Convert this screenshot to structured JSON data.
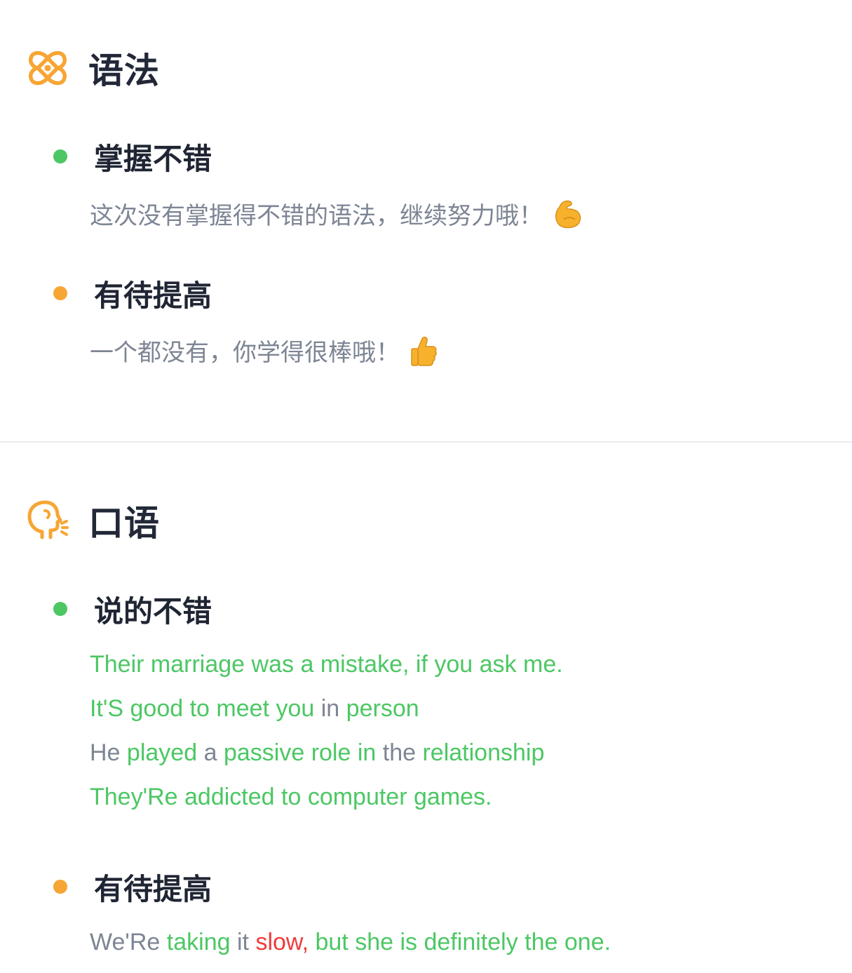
{
  "colors": {
    "good": "#4cc764",
    "neutral": "#7d8594",
    "bad": "#ef3b3b",
    "accent": "#f7a534"
  },
  "grammar": {
    "title": "语法",
    "icon": "grammar-knot-icon",
    "good": {
      "label": "掌握不错",
      "desc": "这次没有掌握得不错的语法，继续努力哦！",
      "emoji": "flexed-biceps-icon"
    },
    "improve": {
      "label": "有待提高",
      "desc": "一个都没有，你学得很棒哦！",
      "emoji": "thumbs-up-icon"
    }
  },
  "speaking": {
    "title": "口语",
    "icon": "speaking-head-icon",
    "good": {
      "label": "说的不错",
      "sentences": [
        [
          {
            "t": "Their",
            "s": "good"
          },
          {
            "t": " ",
            "s": "good"
          },
          {
            "t": "marriage",
            "s": "good"
          },
          {
            "t": " ",
            "s": "good"
          },
          {
            "t": "was",
            "s": "good"
          },
          {
            "t": " ",
            "s": "good"
          },
          {
            "t": "a",
            "s": "good"
          },
          {
            "t": " ",
            "s": "good"
          },
          {
            "t": "mistake,",
            "s": "good"
          },
          {
            "t": " ",
            "s": "good"
          },
          {
            "t": "if",
            "s": "good"
          },
          {
            "t": " ",
            "s": "good"
          },
          {
            "t": "you",
            "s": "good"
          },
          {
            "t": " ",
            "s": "good"
          },
          {
            "t": "ask",
            "s": "good"
          },
          {
            "t": " ",
            "s": "good"
          },
          {
            "t": "me.",
            "s": "good"
          }
        ],
        [
          {
            "t": "It'S",
            "s": "good"
          },
          {
            "t": " ",
            "s": "good"
          },
          {
            "t": "good",
            "s": "good"
          },
          {
            "t": " ",
            "s": "good"
          },
          {
            "t": "to",
            "s": "good"
          },
          {
            "t": " ",
            "s": "good"
          },
          {
            "t": "meet",
            "s": "good"
          },
          {
            "t": " ",
            "s": "good"
          },
          {
            "t": "you",
            "s": "good"
          },
          {
            "t": " ",
            "s": "good"
          },
          {
            "t": "in",
            "s": "neutral"
          },
          {
            "t": " ",
            "s": "good"
          },
          {
            "t": "person",
            "s": "good"
          }
        ],
        [
          {
            "t": "He",
            "s": "neutral"
          },
          {
            "t": " ",
            "s": "neutral"
          },
          {
            "t": "played",
            "s": "good"
          },
          {
            "t": " ",
            "s": "good"
          },
          {
            "t": "a",
            "s": "neutral"
          },
          {
            "t": " ",
            "s": "good"
          },
          {
            "t": "passive",
            "s": "good"
          },
          {
            "t": " ",
            "s": "good"
          },
          {
            "t": "role",
            "s": "good"
          },
          {
            "t": " ",
            "s": "good"
          },
          {
            "t": "in",
            "s": "good"
          },
          {
            "t": " ",
            "s": "good"
          },
          {
            "t": "the",
            "s": "neutral"
          },
          {
            "t": " ",
            "s": "good"
          },
          {
            "t": "relationship",
            "s": "good"
          }
        ],
        [
          {
            "t": "They'Re",
            "s": "good"
          },
          {
            "t": " ",
            "s": "good"
          },
          {
            "t": "addicted",
            "s": "good"
          },
          {
            "t": " ",
            "s": "good"
          },
          {
            "t": "to",
            "s": "good"
          },
          {
            "t": " ",
            "s": "good"
          },
          {
            "t": "computer",
            "s": "good"
          },
          {
            "t": " ",
            "s": "good"
          },
          {
            "t": "games.",
            "s": "good"
          }
        ]
      ]
    },
    "improve": {
      "label": "有待提高",
      "sentences": [
        [
          {
            "t": "We'Re",
            "s": "neutral"
          },
          {
            "t": " ",
            "s": "neutral"
          },
          {
            "t": "taking",
            "s": "good"
          },
          {
            "t": " ",
            "s": "good"
          },
          {
            "t": "it",
            "s": "neutral"
          },
          {
            "t": " ",
            "s": "neutral"
          },
          {
            "t": "slow,",
            "s": "bad"
          },
          {
            "t": " ",
            "s": "good"
          },
          {
            "t": "but",
            "s": "good"
          },
          {
            "t": " ",
            "s": "good"
          },
          {
            "t": "she",
            "s": "good"
          },
          {
            "t": " ",
            "s": "good"
          },
          {
            "t": "is",
            "s": "good"
          },
          {
            "t": " ",
            "s": "good"
          },
          {
            "t": "definitely",
            "s": "good"
          },
          {
            "t": " ",
            "s": "good"
          },
          {
            "t": "the",
            "s": "good"
          },
          {
            "t": " ",
            "s": "good"
          },
          {
            "t": "one.",
            "s": "good"
          }
        ]
      ]
    }
  }
}
